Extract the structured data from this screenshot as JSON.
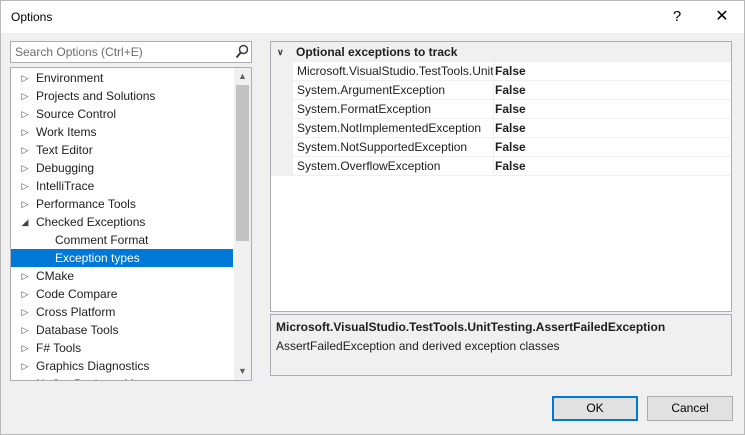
{
  "window": {
    "title": "Options",
    "help_label": "?",
    "close_label": "✕"
  },
  "search": {
    "placeholder": "Search Options (Ctrl+E)",
    "value": ""
  },
  "tree": {
    "items": [
      {
        "label": "Environment",
        "arrow": "▷"
      },
      {
        "label": "Projects and Solutions",
        "arrow": "▷"
      },
      {
        "label": "Source Control",
        "arrow": "▷"
      },
      {
        "label": "Work Items",
        "arrow": "▷"
      },
      {
        "label": "Text Editor",
        "arrow": "▷"
      },
      {
        "label": "Debugging",
        "arrow": "▷"
      },
      {
        "label": "IntelliTrace",
        "arrow": "▷"
      },
      {
        "label": "Performance Tools",
        "arrow": "▷"
      },
      {
        "label": "Checked Exceptions",
        "arrow": "◢"
      },
      {
        "label": "Comment Format"
      },
      {
        "label": "Exception types"
      },
      {
        "label": "CMake",
        "arrow": "▷"
      },
      {
        "label": "Code Compare",
        "arrow": "▷"
      },
      {
        "label": "Cross Platform",
        "arrow": "▷"
      },
      {
        "label": "Database Tools",
        "arrow": "▷"
      },
      {
        "label": "F# Tools",
        "arrow": "▷"
      },
      {
        "label": "Graphics Diagnostics",
        "arrow": "▷"
      },
      {
        "label": "NuGet Package Manager",
        "arrow": "▷"
      }
    ],
    "selected_index": 10,
    "scroll_up": "▲",
    "scroll_down": "▼"
  },
  "grid": {
    "category": {
      "chevron": "∨",
      "label": "Optional exceptions to track"
    },
    "rows": [
      {
        "name": "Microsoft.VisualStudio.TestTools.UnitTesting.AssertFailedException",
        "value": "False"
      },
      {
        "name": "System.ArgumentException",
        "value": "False"
      },
      {
        "name": "System.FormatException",
        "value": "False"
      },
      {
        "name": "System.NotImplementedException",
        "value": "False"
      },
      {
        "name": "System.NotSupportedException",
        "value": "False"
      },
      {
        "name": "System.OverflowException",
        "value": "False"
      }
    ]
  },
  "description": {
    "title": "Microsoft.VisualStudio.TestTools.UnitTesting.AssertFailedException",
    "text": "AssertFailedException and derived exception classes"
  },
  "buttons": {
    "ok": "OK",
    "cancel": "Cancel"
  },
  "colors": {
    "selection": "#0078d7",
    "panel": "#f0f0f0",
    "border": "#abadb3"
  }
}
